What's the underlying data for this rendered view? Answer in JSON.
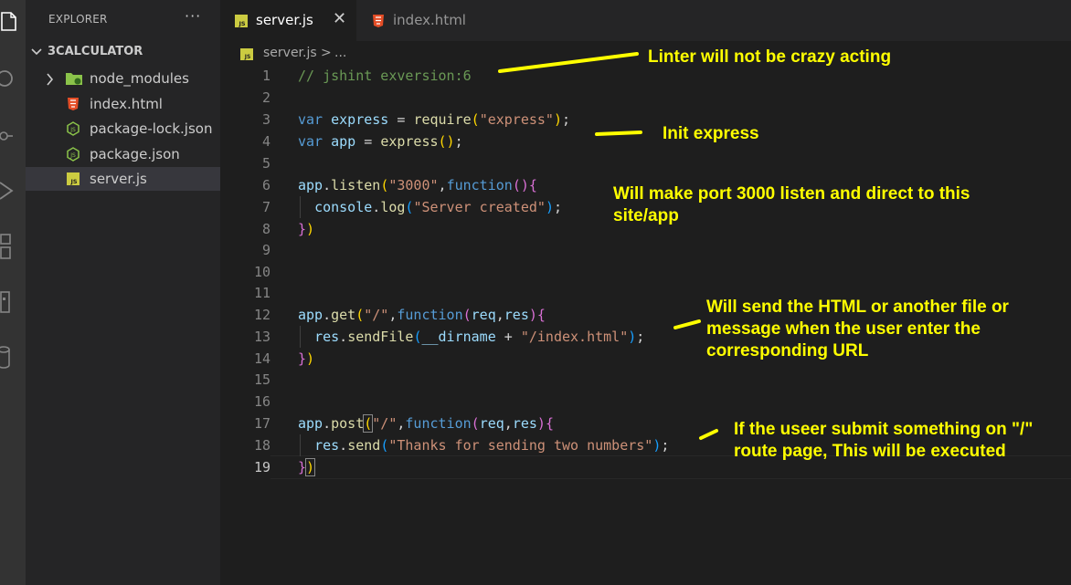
{
  "sidebar": {
    "title": "EXPLORER",
    "more": "···",
    "folder": "3CALCULATOR",
    "items": [
      {
        "label": "node_modules"
      },
      {
        "label": "index.html"
      },
      {
        "label": "package-lock.json"
      },
      {
        "label": "package.json"
      },
      {
        "label": "server.js"
      }
    ]
  },
  "tabs": [
    {
      "label": "server.js",
      "close": "✕"
    },
    {
      "label": "index.html"
    }
  ],
  "breadcrumb": {
    "file": "server.js",
    "sep": ">",
    "more": "..."
  },
  "editor": {
    "current_line": 19,
    "line_numbers": [
      "1",
      "2",
      "3",
      "4",
      "5",
      "6",
      "7",
      "8",
      "9",
      "10",
      "11",
      "12",
      "13",
      "14",
      "15",
      "16",
      "17",
      "18",
      "19"
    ]
  },
  "annotations": [
    {
      "text": "Linter will not be crazy acting"
    },
    {
      "text": "Init express"
    },
    {
      "text": "Will make port 3000 listen and direct to this site/app"
    },
    {
      "text": "Will send the HTML or another file or message when the user enter the corresponding URL"
    },
    {
      "text": "If the useer submit something on \"/\" route page, This will be executed"
    }
  ],
  "colors": {
    "annotation": "#ffff00",
    "js_icon": "#cbcb41",
    "html_icon": "#e44d26",
    "json_icon": "#8bc34a",
    "folder_icon": "#8bc34a"
  }
}
